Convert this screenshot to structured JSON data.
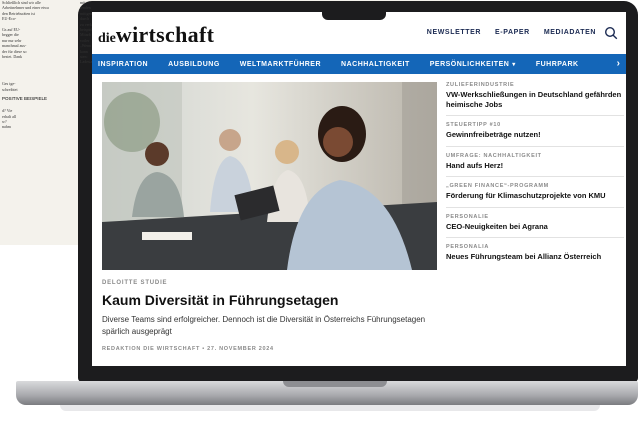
{
  "site": {
    "logo_prefix": "die",
    "logo_main": "wirtschaft",
    "top_links": [
      "NEWSLETTER",
      "E-PAPER",
      "MEDIADATEN"
    ]
  },
  "nav": {
    "items": [
      "INSPIRATION",
      "AUSBILDUNG",
      "WELTMARKTFÜHRER",
      "NACHHALTIGKEIT",
      "PERSÖNLICHKEITEN",
      "FUHRPARK"
    ],
    "dropdown_item_index": 4
  },
  "feature": {
    "kicker": "DELOITTE STUDIE",
    "headline": "Kaum Diversität in Führungsetagen",
    "teaser": "Diverse Teams sind erfolgreicher. Dennoch ist die Diversität in Österreichs Führungsetagen spärlich ausgeprägt",
    "byline": "REDAKTION DIE WIRTSCHAFT • 27. NOVEMBER 2024"
  },
  "sidebar": [
    {
      "kicker": "ZULIEFERINDUSTRIE",
      "title": "VW-Werkschließungen in Deutschland gefährden heimische Jobs"
    },
    {
      "kicker": "STEUERTIPP #10",
      "title": "Gewinnfreibeträge nutzen!"
    },
    {
      "kicker": "UMFRAGE: NACHHALTIGKEIT",
      "title": "Hand aufs Herz!"
    },
    {
      "kicker": "„GREEN FINANCE“-PROGRAMM",
      "title": "Förderung für Klimaschutzprojekte von KMU"
    },
    {
      "kicker": "PERSONALIE",
      "title": "CEO-Neuigkeiten bei Agrana"
    },
    {
      "kicker": "PERSONALIA",
      "title": "Neues Führungsteam bei Allianz Österreich"
    }
  ],
  "background_paper": {
    "col1": "Schließlich sind wir alle\nArbeitnehmer und einer etwa\nden Betriebsräten ist\nEU-Eco-\n\nGs auf EU-\nbegger die\nnur nur sehr\nmanchmal aus-\nder für diese so\nbestet. Dank\n\n\n\n\nGes ige-\nschreibtet\n\n\n\nd? Vie\nerhalt all\nw?\nnahm",
    "col2": "mit\ntenden\nmitigen\ndurch\nzu verk\nbeispiel\nMitarb\nvoiler\n„Wenn\nkann\nsten:\nLadesta",
    "strip": "mit Partnern, Kunden, Nachbarfirmen und Mitarbei-    Hauptsächliche Beratung  Da wir dem Grundsa-    verkommen im tatsächlich schaffen Ich fahr 1",
    "accent_label": "POSITIVE BEISPIELE",
    "fragments": [
      "E-Bikes können m",
      "geladen werden. D",
      "„Wenn jemand mi",
      "der Früh anstecke",
      "Akku wieder nac",
      "Sonne scheint ob",
      "Antrieb für das a",
      "„Wenn ich damit i",
      "aufs Fahrrad zu s",
      "habe ich schon w",
      "für die Gesellsch",
      "Generation seine",
      "Nachwelt zeigen,",
      "seine Generation",
      "mit ruhigem Gew",
      "hoffe, sie ist stolz",
      "Derzeit hat die",
      "der Druckerei vo",
      "Nachbarschaft. W"
    ]
  }
}
